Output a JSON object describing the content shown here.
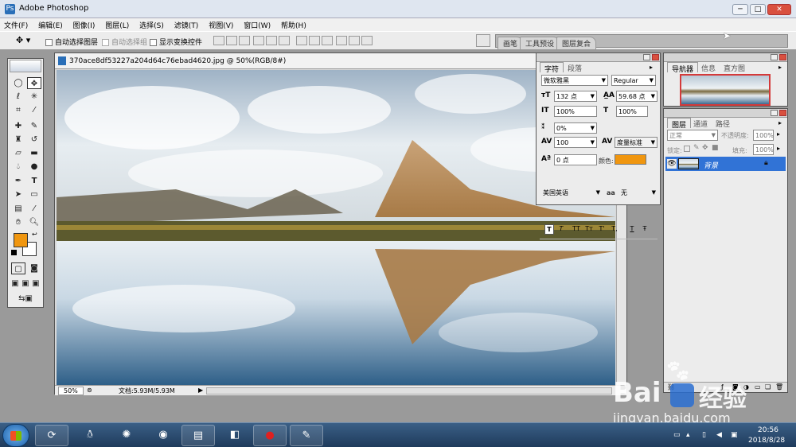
{
  "app": {
    "title": "Adobe Photoshop",
    "window_buttons": [
      "─",
      "□",
      "✕"
    ]
  },
  "menu": [
    "文件(F)",
    "编辑(E)",
    "图像(I)",
    "图层(L)",
    "选择(S)",
    "滤镜(T)",
    "视图(V)",
    "窗口(W)",
    "帮助(H)"
  ],
  "options": {
    "auto_select_layer": "自动选择图层",
    "auto_select_group": "自动选择组",
    "show_transform": "显示变换控件"
  },
  "palette_well": [
    "画笔",
    "工具预设",
    "图层复合"
  ],
  "document": {
    "title": "370ace8df53227a204d64c76ebad4620.jpg @ 50%(RGB/8#)",
    "zoom": "50%",
    "doc_info": "文档:5.93M/5.93M"
  },
  "colors": {
    "foreground": "#f0960f",
    "background": "#ffffff",
    "accent": "#1f6fd1",
    "layer_sel": "#3173d6"
  },
  "character_panel": {
    "tabs": [
      "字符",
      "段落"
    ],
    "font_family": "微软雅黑",
    "font_style": "Regular",
    "font_size": "132 点",
    "leading": "59.68 点",
    "vertical_scale": "100%",
    "horizontal_scale": "100%",
    "kerning": "0%",
    "tracking": "100",
    "kerning_mode": "度量标准",
    "baseline_shift": "0 点",
    "color_label": "颜色:",
    "style_buttons": [
      "T",
      "T",
      "TT",
      "Tт",
      "T'",
      "T,",
      "T",
      "Ŧ"
    ],
    "language": "美国英语",
    "aa_label": "aa",
    "anti_alias": "无"
  },
  "navigator_panel": {
    "tabs": [
      "导航器",
      "信息",
      "直方图"
    ]
  },
  "layers_panel": {
    "tabs": [
      "图层",
      "通道",
      "路径"
    ],
    "blend_mode": "正常",
    "opacity_label": "不透明度:",
    "opacity": "100%",
    "lock_label": "锁定:",
    "fill_label": "填充:",
    "fill": "100%",
    "layers": [
      {
        "name": "背景",
        "visible": true,
        "locked": true,
        "selected": true
      }
    ]
  },
  "taskbar": {
    "time": "20:56",
    "date": "2018/8/28"
  },
  "watermark": {
    "brand": "Bai",
    "brand2": "经验",
    "url": "jingyan.baidu.com"
  }
}
